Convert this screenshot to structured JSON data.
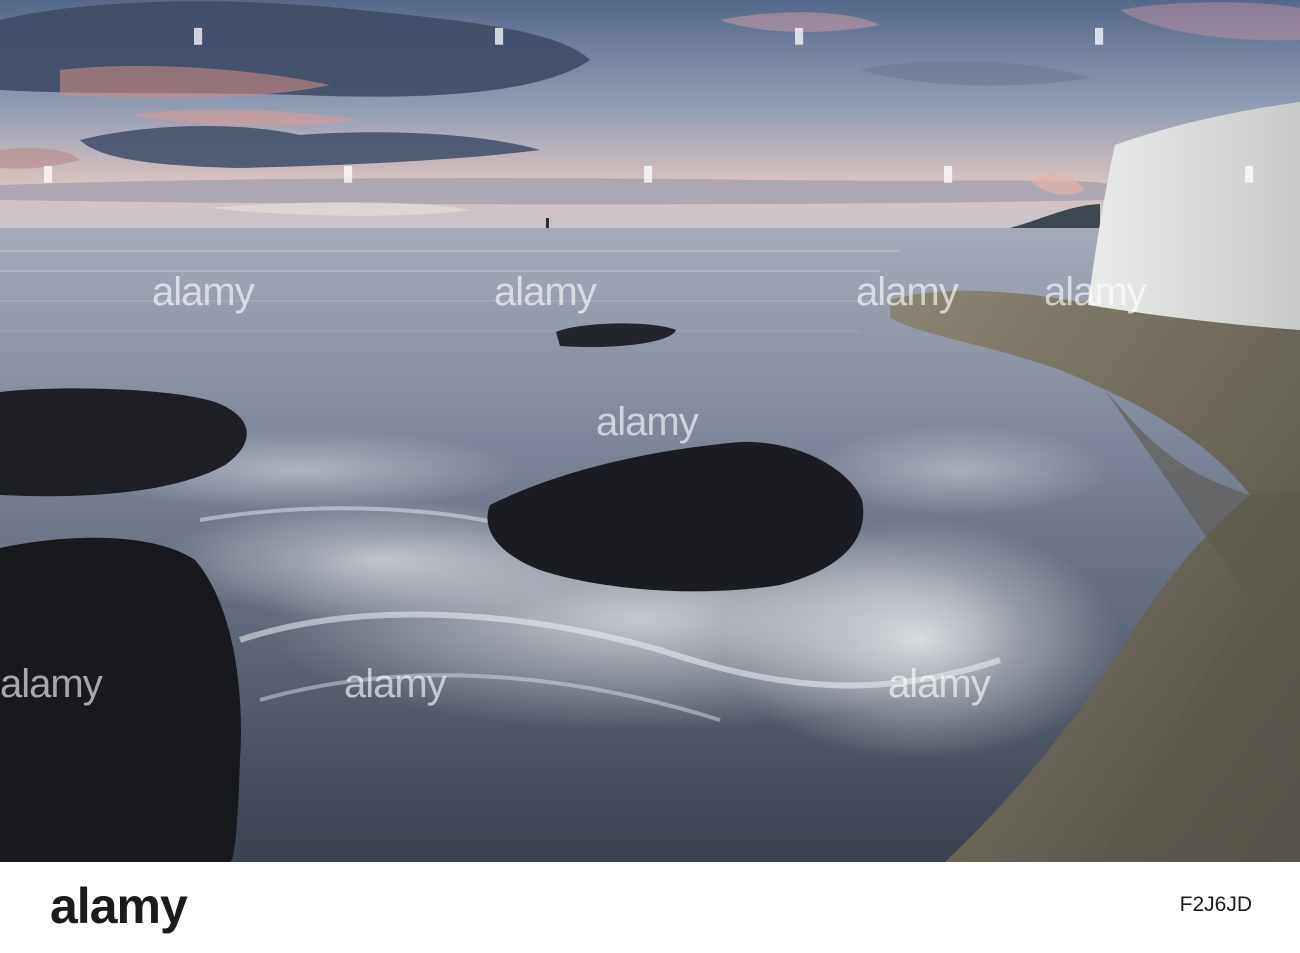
{
  "watermark": {
    "text": "alamy"
  },
  "footer": {
    "logo_text": "alamy",
    "image_id": "F2J6JD"
  },
  "colors": {
    "sky_top": "#5b6b88",
    "horizon_glow": "#e7b9a8",
    "sea": "#6e7a8f",
    "rock": "#1c1d22",
    "wall": "#d9dcd9",
    "seawall": "#6d6a5e"
  }
}
